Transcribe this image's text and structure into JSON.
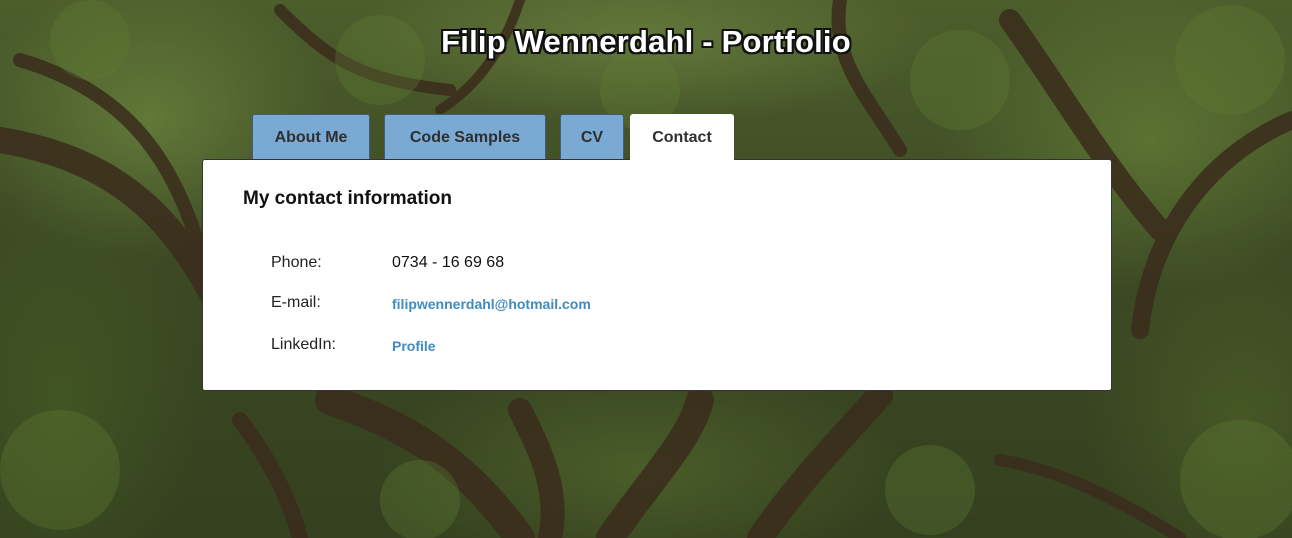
{
  "header": {
    "title": "Filip Wennerdahl - Portfolio"
  },
  "tabs": [
    {
      "label": "About Me",
      "active": false
    },
    {
      "label": "Code Samples",
      "active": false
    },
    {
      "label": "CV",
      "active": false
    },
    {
      "label": "Contact",
      "active": true
    }
  ],
  "contact": {
    "heading": "My contact information",
    "rows": [
      {
        "label": "Phone:",
        "value": "0734 - 16 69 68"
      },
      {
        "label": "E-mail:",
        "value": "filipwennerdahl@hotmail.com"
      },
      {
        "label": "LinkedIn:",
        "value": "Profile"
      }
    ]
  },
  "colors": {
    "tab_inactive": "#7aa9d3",
    "tab_active": "#ffffff",
    "link": "#3f8cc0",
    "panel": "#ffffff"
  }
}
